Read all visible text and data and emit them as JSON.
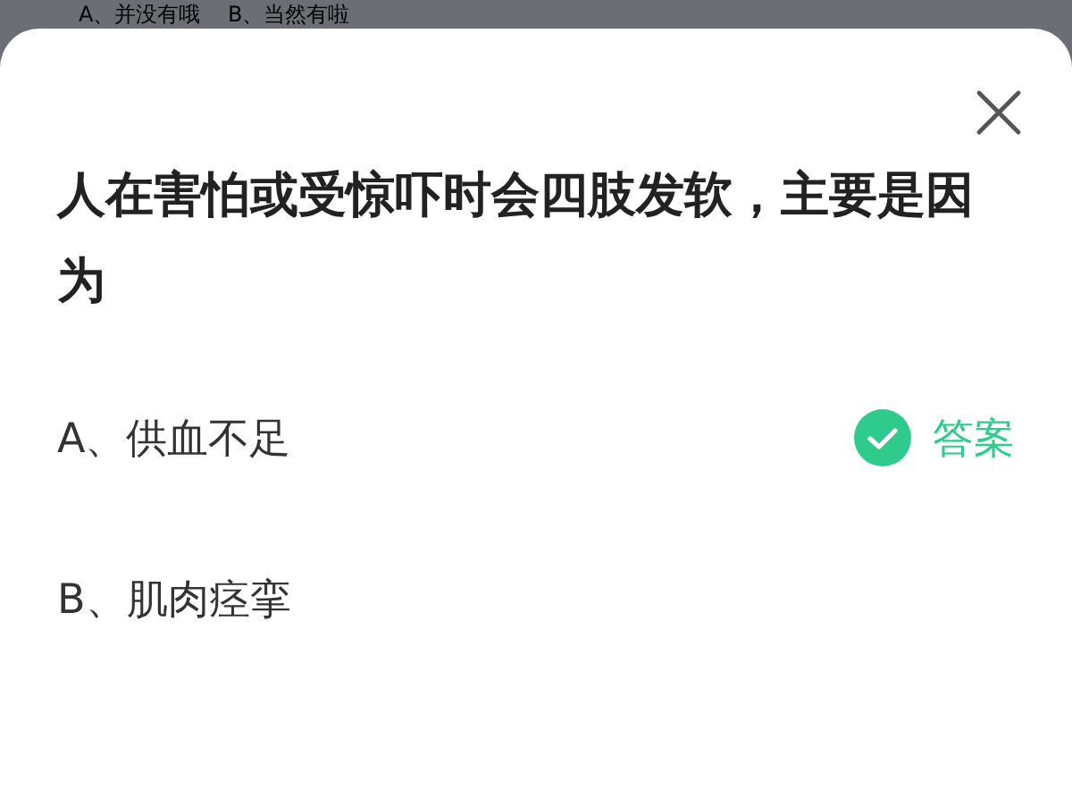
{
  "backdrop": {
    "text": "A、并没有哦    B、当然有啦"
  },
  "question": "人在害怕或受惊吓时会四肢发软，主要是因为",
  "answer_label": "答案",
  "options": [
    {
      "label": "A、供血不足",
      "correct": true
    },
    {
      "label": "B、肌肉痉挛",
      "correct": false
    }
  ]
}
